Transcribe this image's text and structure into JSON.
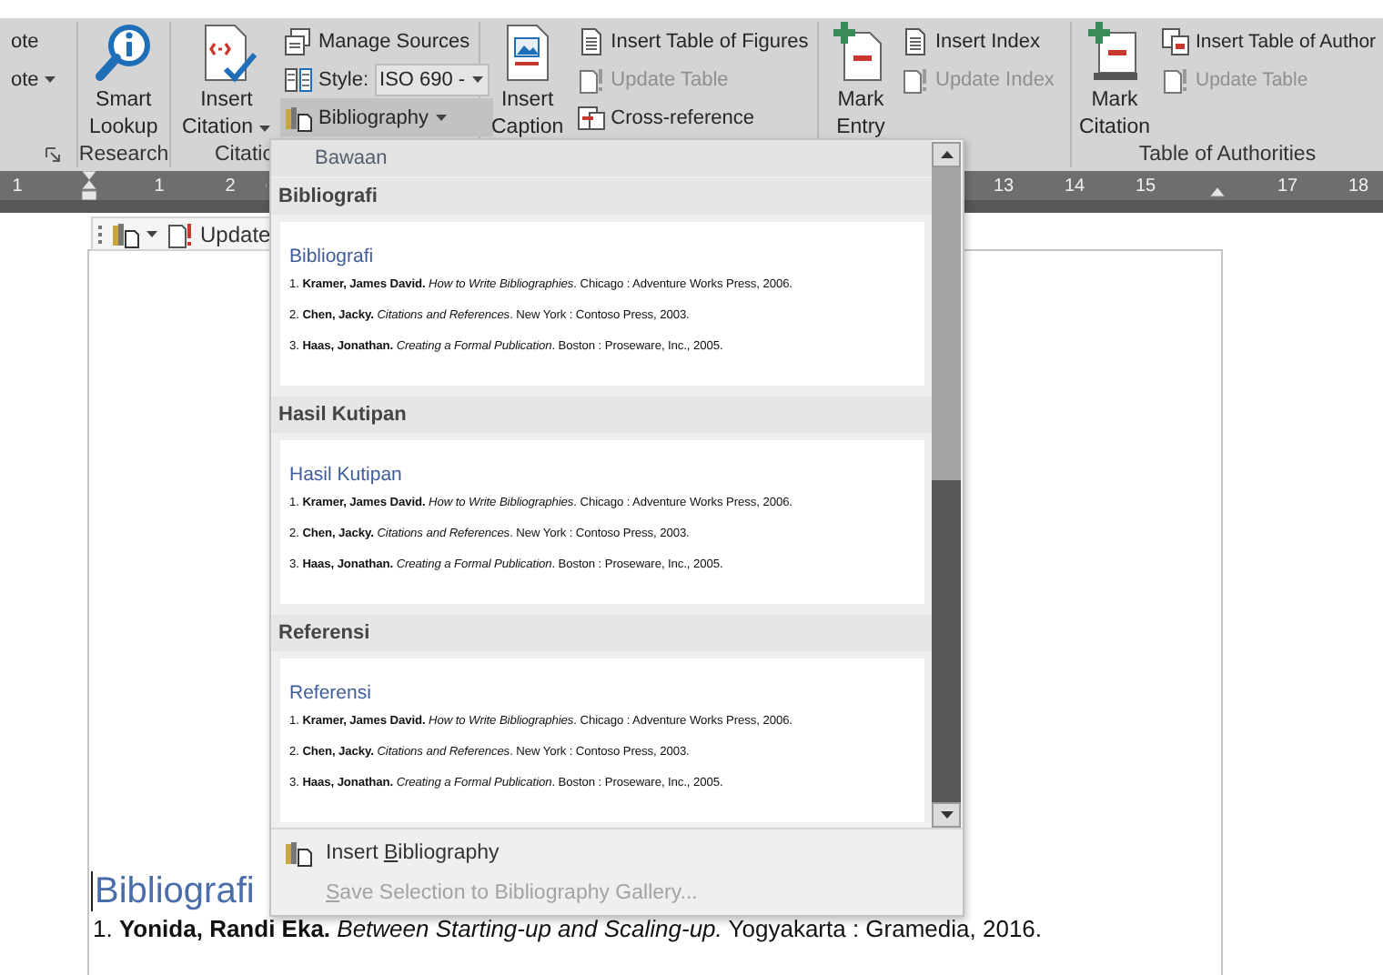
{
  "ribbon": {
    "groups": [
      {
        "launcher": true,
        "small": [
          {
            "kind": "button",
            "label": "ote",
            "dropdown": false,
            "expanded": false,
            "disabled": false
          },
          {
            "kind": "button",
            "label": "ote",
            "dropdown": true,
            "expanded": false,
            "disabled": false
          }
        ]
      },
      {
        "label": "Research",
        "large": [
          {
            "lines": [
              "Smart",
              "Lookup"
            ],
            "dropdown": false,
            "expanded": false
          }
        ]
      },
      {
        "label": "Citatic",
        "large": [
          {
            "lines": [
              "Insert",
              "Citation"
            ],
            "dropdown": true,
            "expanded": false
          }
        ],
        "small": [
          {
            "kind": "button",
            "label": "Manage Sources",
            "dropdown": false,
            "expanded": false,
            "disabled": false
          },
          {
            "kind": "combo",
            "label": "Style:",
            "value": "ISO 690 -",
            "dropdown": true,
            "expanded": false,
            "disabled": false
          },
          {
            "kind": "button",
            "label": "Bibliography",
            "dropdown": true,
            "expanded": true,
            "disabled": false
          }
        ]
      },
      {
        "large": [
          {
            "lines": [
              "Insert",
              "Caption"
            ],
            "dropdown": false,
            "expanded": false
          }
        ],
        "small": [
          {
            "kind": "button",
            "label": "Insert Table of Figures",
            "dropdown": false,
            "expanded": false,
            "disabled": false
          },
          {
            "kind": "button",
            "label": "Update Table",
            "dropdown": false,
            "expanded": false,
            "disabled": true
          },
          {
            "kind": "button",
            "label": "Cross-reference",
            "dropdown": false,
            "expanded": false,
            "disabled": false
          }
        ]
      },
      {
        "large": [
          {
            "lines": [
              "Mark",
              "Entry"
            ],
            "dropdown": false,
            "expanded": false
          }
        ],
        "small": [
          {
            "kind": "button",
            "label": "Insert Index",
            "dropdown": false,
            "expanded": false,
            "disabled": false
          },
          {
            "kind": "button",
            "label": "Update Index",
            "dropdown": false,
            "expanded": false,
            "disabled": true
          }
        ]
      },
      {
        "label": "Table of Authorities",
        "large": [
          {
            "lines": [
              "Mark",
              "Citation"
            ],
            "dropdown": false,
            "expanded": false
          }
        ],
        "small": [
          {
            "kind": "button",
            "label": "Insert Table of Author",
            "dropdown": false,
            "expanded": false,
            "disabled": false
          },
          {
            "kind": "button",
            "label": "Update Table",
            "dropdown": false,
            "expanded": false,
            "disabled": true
          }
        ]
      }
    ]
  },
  "ruler": {
    "left_marks": [
      {
        "kind": "number",
        "label": "1"
      },
      {
        "kind": "indent"
      },
      {
        "kind": "number",
        "label": "1"
      },
      {
        "kind": "number",
        "label": "2"
      }
    ],
    "right_marks": [
      {
        "kind": "number",
        "label": "13"
      },
      {
        "kind": "number",
        "label": "14"
      },
      {
        "kind": "number",
        "label": "15"
      },
      {
        "kind": "indent"
      },
      {
        "kind": "number",
        "label": "17"
      },
      {
        "kind": "number",
        "label": "18"
      }
    ]
  },
  "document": {
    "control_bar": {
      "label": "Update"
    },
    "heading": "Bibliografi",
    "entries": [
      "1. **Yonida, Randi Eka.** *Between Starting-up and Scaling-up.* Yogyakarta : Gramedia, 2016."
    ]
  },
  "bibliography_menu": {
    "header": "Bawaan",
    "sections": [
      {
        "title": "Bibliografi",
        "preview": {
          "heading": "Bibliografi",
          "entries": [
            "1. **Kramer, James David.** *How to Write Bibliographies*. Chicago : Adventure Works Press, 2006.",
            "2. **Chen, Jacky.** *Citations and References*. New York : Contoso Press, 2003.",
            "3. **Haas, Jonathan.** *Creating a Formal Publication*. Boston : Proseware, Inc., 2005."
          ]
        }
      },
      {
        "title": "Hasil Kutipan",
        "preview": {
          "heading": "Hasil Kutipan",
          "entries": [
            "1. **Kramer, James David.** *How to Write Bibliographies*. Chicago : Adventure Works Press, 2006.",
            "2. **Chen, Jacky.** *Citations and References*. New York : Contoso Press, 2003.",
            "3. **Haas, Jonathan.** *Creating a Formal Publication*. Boston : Proseware, Inc., 2005."
          ]
        }
      },
      {
        "title": "Referensi",
        "preview": {
          "heading": "Referensi",
          "entries": [
            "1. **Kramer, James David.** *How to Write Bibliographies*. Chicago : Adventure Works Press, 2006.",
            "2. **Chen, Jacky.** *Citations and References*. New York : Contoso Press, 2003.",
            "3. **Haas, Jonathan.** *Creating a Formal Publication*. Boston : Proseware, Inc., 2005."
          ]
        }
      }
    ],
    "actions": [
      {
        "before": "Insert ",
        "key": "B",
        "after": "ibliography",
        "disabled": false
      },
      {
        "key": "S",
        "after": "ave Selection to Bibliography Gallery...",
        "disabled": true
      }
    ]
  }
}
